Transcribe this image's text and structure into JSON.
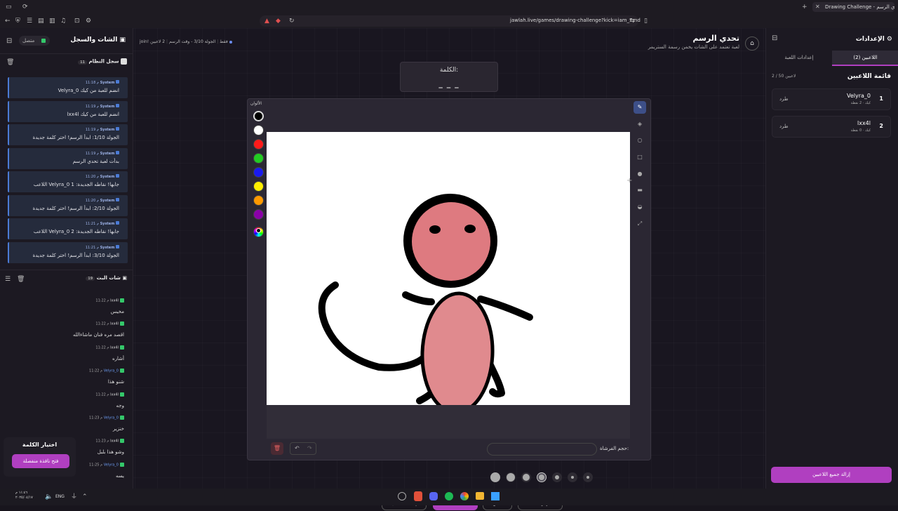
{
  "browser": {
    "tab_title": "Drawing Challenge - تحدي الرسم",
    "url": "jawlah.live/games/drawing-challenge?kick=iam_7md"
  },
  "left": {
    "header_title": "الشات والسجل",
    "connected_label": "متصل",
    "system_log_title": "سجل النظام",
    "system_log_count": "11",
    "system_messages": [
      {
        "sender": "System",
        "time": "11:18 م",
        "text": "Velyra_0 انضم للعبة من كيك"
      },
      {
        "sender": "System",
        "time": "11:19 م",
        "text": "lxx4l انضم للعبة من كيك"
      },
      {
        "sender": "System",
        "time": "11:19 م",
        "text": "الجولة 1/10: ابدأ الرسم! اختر كلمة جديدة"
      },
      {
        "sender": "System",
        "time": "11:19 م",
        "text": "بدأت لعبة تحدي الرسم"
      },
      {
        "sender": "System",
        "time": "11:20 م",
        "text": "اللاعب Velyra_0 جابها! نقاطه الجديدة: 1"
      },
      {
        "sender": "System",
        "time": "11:20 م",
        "text": "الجولة 2/10: ابدأ الرسم! اختر كلمة جديدة"
      },
      {
        "sender": "System",
        "time": "11:21 م",
        "text": "اللاعب Velyra_0 جابها! نقاطه الجديدة: 2"
      },
      {
        "sender": "System",
        "time": "11:21 م",
        "text": "الجولة 3/10: ابدأ الرسم! اختر كلمة جديدة"
      }
    ],
    "live_chat_title": "شات البث",
    "live_chat_count": "19",
    "chat_messages": [
      {
        "name": "lxx4l",
        "time": "11:22 م",
        "text": "مخيس",
        "blue": false
      },
      {
        "name": "lxx4l",
        "time": "11:22 م",
        "text": "اقصد مره فنان ماشاءالله",
        "blue": false
      },
      {
        "name": "lxx4l",
        "time": "11:22 م",
        "text": "أشاره",
        "blue": false
      },
      {
        "name": "Velyra_0",
        "time": "11:22 م",
        "text": "شنو هذا",
        "blue": true
      },
      {
        "name": "lxx4l",
        "time": "11:22 م",
        "text": "وجه",
        "blue": false
      },
      {
        "name": "Velyra_0",
        "time": "11:23 م",
        "text": "خنزير",
        "blue": true
      },
      {
        "name": "lxx4l",
        "time": "11:23 م",
        "text": "وشو هذا بلبل",
        "blue": false
      },
      {
        "name": "Velyra_0",
        "time": "11:25 م",
        "text": "يسه",
        "blue": true
      }
    ],
    "word_pick_title": "اختيار الكلمة",
    "word_pick_button": "فتح نافذة منفصلة"
  },
  "header": {
    "title": "تحدي الرسم",
    "subtitle": "لعبة تعتمد على الشات يخمن رسمة الستريمر",
    "players_count": "2 لاعبين",
    "round_info": "الجولة 3/10 - وقت الرسم",
    "join_hint": "join! فقط"
  },
  "word": {
    "label": "الكلمة:",
    "blanks": "_ _ _"
  },
  "canvas": {
    "colors_label": "الألوان",
    "colors": [
      "#000000",
      "#ffffff",
      "#ff1a1a",
      "#22cc22",
      "#1a1aee",
      "#ffee00",
      "#ff9900",
      "#8a00a8"
    ],
    "brush_size_label": "حجم الفرشاة:"
  },
  "controls": {
    "end_game": "إنهاء اللعبة",
    "restart": "إعادة تشغيل",
    "next_round": "الجولة التالية",
    "hint": "تلميح",
    "show_word": "اظهار الكلمة"
  },
  "right": {
    "settings_title": "الإعدادات",
    "tab_players": "اللاعبين (2)",
    "tab_game_settings": "إعدادات اللعبة",
    "players_list_title": "قائمة اللاعبين",
    "players_capacity": "2 / 50 لاعبين",
    "players": [
      {
        "rank": "1",
        "name": "Velyra_0",
        "meta": "كيك · 2 نقطة",
        "kick": "طرد"
      },
      {
        "rank": "2",
        "name": "lxx4l",
        "meta": "كيك · 0 نقطة",
        "kick": "طرد"
      }
    ],
    "remove_all": "إزالة جميع اللاعبين"
  },
  "taskbar": {
    "lang": "ENG",
    "time": "١١:٤٦ م",
    "date": "٢٠٢٥/٠٤/١٧"
  }
}
